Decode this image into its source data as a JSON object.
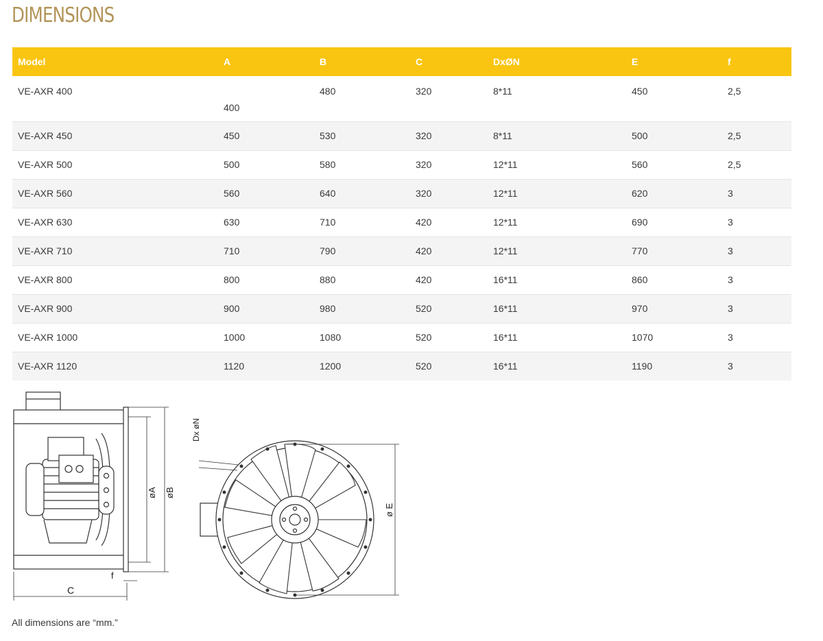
{
  "page": {
    "title": "DIMENSIONS"
  },
  "table": {
    "headers": {
      "model": "Model",
      "a": "A",
      "b": "B",
      "c": "C",
      "d": "DxØN",
      "e": "E",
      "f": "f"
    },
    "rows": [
      {
        "model": "VE-AXR 400",
        "a": "400",
        "b": "480",
        "c": "320",
        "d": "8*11",
        "e": "450",
        "f": "2,5"
      },
      {
        "model": "VE-AXR 450",
        "a": "450",
        "b": "530",
        "c": "320",
        "d": "8*11",
        "e": "500",
        "f": "2,5"
      },
      {
        "model": "VE-AXR 500",
        "a": "500",
        "b": "580",
        "c": "320",
        "d": "12*11",
        "e": "560",
        "f": "2,5"
      },
      {
        "model": "VE-AXR 560",
        "a": "560",
        "b": "640",
        "c": "320",
        "d": "12*11",
        "e": "620",
        "f": "3"
      },
      {
        "model": "VE-AXR 630",
        "a": "630",
        "b": "710",
        "c": "420",
        "d": "12*11",
        "e": "690",
        "f": "3"
      },
      {
        "model": "VE-AXR 710",
        "a": "710",
        "b": "790",
        "c": "420",
        "d": "12*11",
        "e": "770",
        "f": "3"
      },
      {
        "model": "VE-AXR 800",
        "a": "800",
        "b": "880",
        "c": "420",
        "d": "16*11",
        "e": "860",
        "f": "3"
      },
      {
        "model": "VE-AXR 900",
        "a": "900",
        "b": "980",
        "c": "520",
        "d": "16*11",
        "e": "970",
        "f": "3"
      },
      {
        "model": "VE-AXR 1000",
        "a": "1000",
        "b": "1080",
        "c": "520",
        "d": "16*11",
        "e": "1070",
        "f": "3"
      },
      {
        "model": "VE-AXR 1120",
        "a": "1120",
        "b": "1200",
        "c": "520",
        "d": "16*11",
        "e": "1190",
        "f": "3"
      }
    ]
  },
  "drawing": {
    "side_view": {
      "label_a": "øA",
      "label_b": "øB",
      "label_c": "C",
      "label_f": "f"
    },
    "front_view": {
      "label_dxn": "Dx øN",
      "label_e": "ø E"
    }
  },
  "footnote": "All dimensions are “mm.”"
}
